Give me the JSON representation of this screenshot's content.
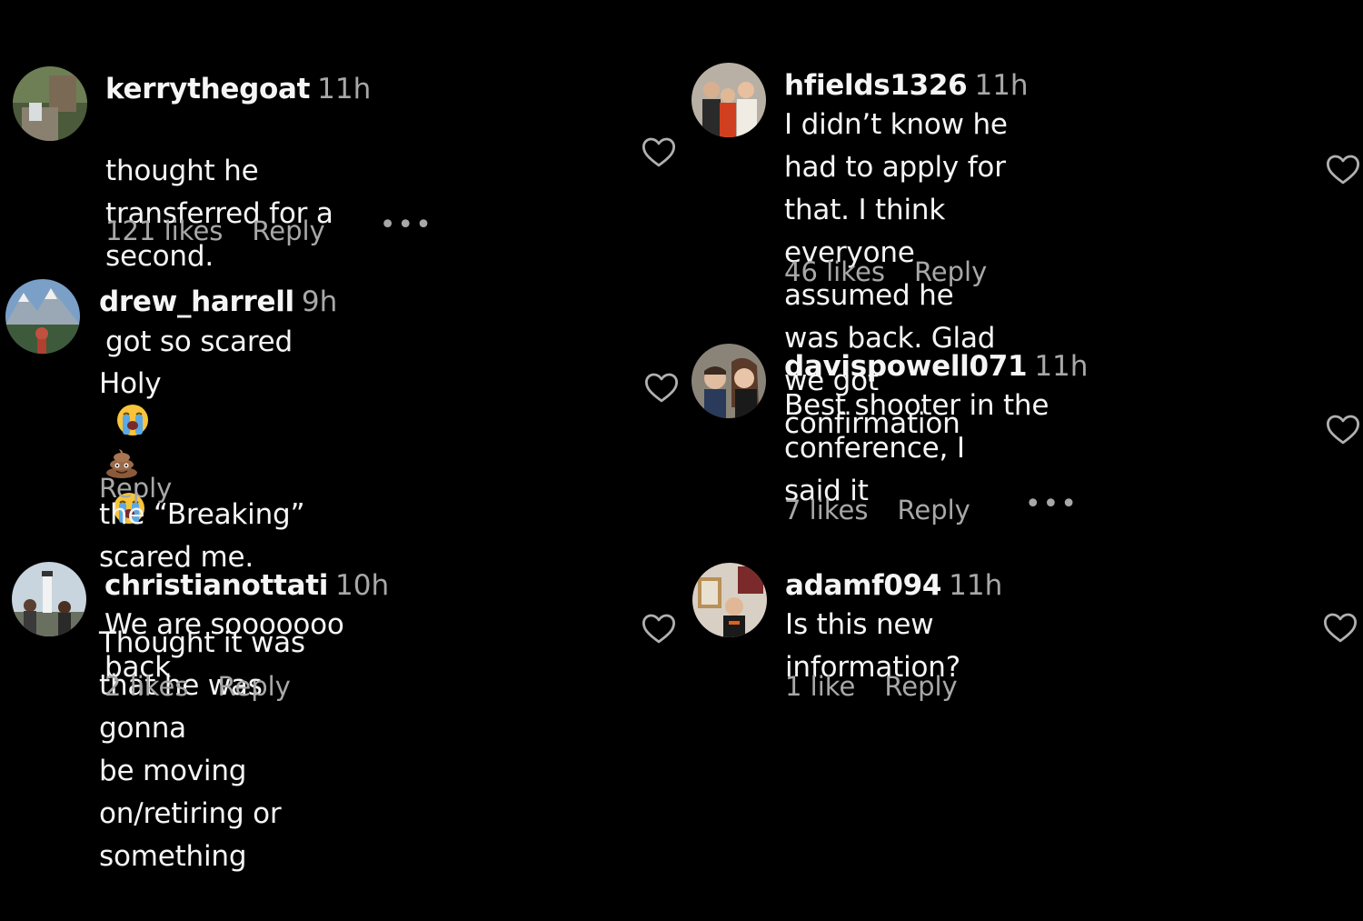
{
  "colors": {
    "background": "#000000",
    "text_primary": "#f5f5f5",
    "text_secondary": "#a8a8a8"
  },
  "comments": [
    {
      "username": "kerrythegoat",
      "time": "11h",
      "text_line1": "thought he transferred for a second.",
      "text_line2": "got so scared",
      "emoji": "loudly-crying-face-icon",
      "likes": "121 likes",
      "reply": "Reply",
      "more": "•••"
    },
    {
      "username": "drew_harrell",
      "time": "9h",
      "text_before_emoji": "Holy",
      "emoji": "pile-of-poo-icon",
      "text_after_emoji": "the “Breaking” scared me.",
      "text_rest": "Thought it was that he was gonna\nbe moving on/retiring or something",
      "reply": "Reply"
    },
    {
      "username": "christianottati",
      "time": "10h",
      "text": "We are sooooooo back",
      "likes": "2 likes",
      "reply": "Reply"
    },
    {
      "username": "hfields1326",
      "time": "11h",
      "text": "I didn’t know he had to apply for\nthat. I think everyone assumed he\nwas back. Glad we got confirmation",
      "likes": "46 likes",
      "reply": "Reply"
    },
    {
      "username": "davispowell071",
      "time": "11h",
      "text": "Best shooter in the conference, I\nsaid it",
      "likes": "7 likes",
      "reply": "Reply",
      "more": "•••"
    },
    {
      "username": "adamf094",
      "time": "11h",
      "text": "Is this new information?",
      "likes": "1 like",
      "reply": "Reply"
    }
  ]
}
